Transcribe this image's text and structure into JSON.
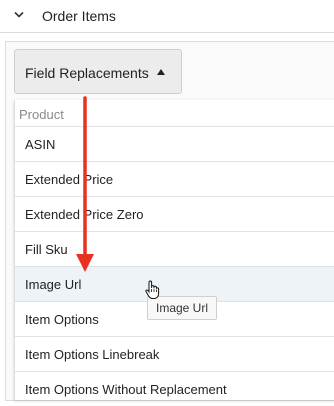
{
  "section": {
    "title": "Order Items",
    "icon": "chevron-down-icon"
  },
  "dropdown": {
    "label": "Field Replacements",
    "icon": "caret-up-icon"
  },
  "menu": {
    "group_label": "Product",
    "items": [
      "ASIN",
      "Extended Price",
      "Extended Price Zero",
      "Fill Sku",
      "Image Url",
      "Item Options",
      "Item Options Linebreak",
      "Item Options Without Replacement"
    ],
    "hovered_index": 4
  },
  "tooltip": {
    "text": "Image Url"
  },
  "annotation": {
    "arrow_color": "#e8321f"
  },
  "colors": {
    "hover_bg": "#eef3f8",
    "border": "#dcdcdc"
  }
}
